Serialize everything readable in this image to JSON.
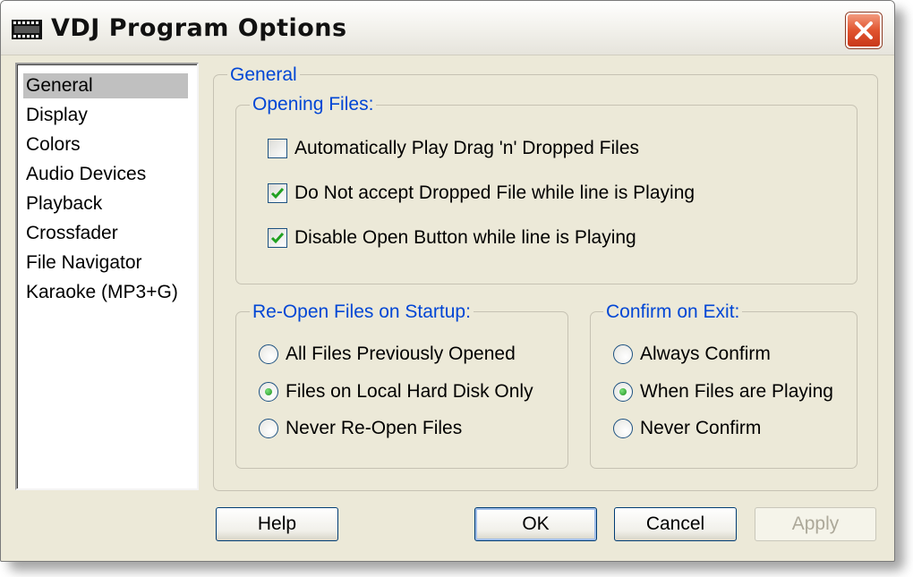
{
  "window": {
    "title": "VDJ Program Options",
    "icon": "film-strip-icon",
    "close_icon": "close-x-icon",
    "accent_color": "#0046d5"
  },
  "nav": {
    "items": [
      {
        "label": "General",
        "selected": true
      },
      {
        "label": "Display",
        "selected": false
      },
      {
        "label": "Colors",
        "selected": false
      },
      {
        "label": "Audio Devices",
        "selected": false
      },
      {
        "label": "Playback",
        "selected": false
      },
      {
        "label": "Crossfader",
        "selected": false
      },
      {
        "label": "File Navigator",
        "selected": false
      },
      {
        "label": "Karaoke (MP3+G)",
        "selected": false
      }
    ]
  },
  "general": {
    "title": "General",
    "opening_files": {
      "title": "Opening Files:",
      "options": [
        {
          "label": "Automatically Play Drag 'n' Dropped Files",
          "checked": false
        },
        {
          "label": "Do Not accept Dropped File while line is Playing",
          "checked": true
        },
        {
          "label": "Disable Open Button while line is Playing",
          "checked": true
        }
      ]
    },
    "reopen": {
      "title": "Re-Open Files on Startup:",
      "options": [
        {
          "label": "All Files Previously Opened",
          "selected": false
        },
        {
          "label": "Files on Local Hard Disk Only",
          "selected": true
        },
        {
          "label": "Never Re-Open Files",
          "selected": false
        }
      ]
    },
    "confirm_exit": {
      "title": "Confirm on Exit:",
      "options": [
        {
          "label": "Always Confirm",
          "selected": false
        },
        {
          "label": "When Files are Playing",
          "selected": true
        },
        {
          "label": "Never Confirm",
          "selected": false
        }
      ]
    }
  },
  "buttons": {
    "help": "Help",
    "ok": "OK",
    "cancel": "Cancel",
    "apply": "Apply",
    "apply_enabled": false
  }
}
